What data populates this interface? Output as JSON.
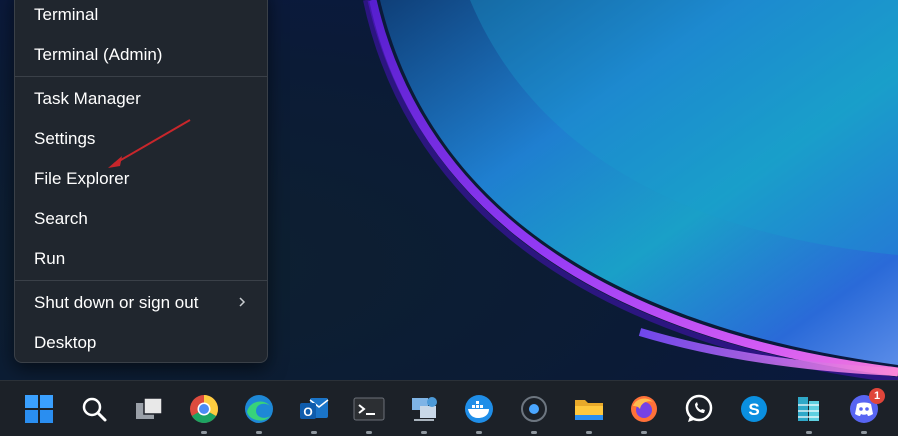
{
  "context_menu": {
    "items": [
      {
        "label": "Terminal"
      },
      {
        "label": "Terminal (Admin)"
      },
      {
        "label": "Task Manager"
      },
      {
        "label": "Settings"
      },
      {
        "label": "File Explorer"
      },
      {
        "label": "Search"
      },
      {
        "label": "Run"
      },
      {
        "label": "Shut down or sign out",
        "has_submenu": true
      },
      {
        "label": "Desktop"
      }
    ]
  },
  "taskbar": {
    "apps": [
      {
        "name": "start",
        "icon": "windows-logo-icon",
        "running": false
      },
      {
        "name": "search",
        "icon": "search-icon",
        "running": false
      },
      {
        "name": "task-view",
        "icon": "task-view-icon",
        "running": false
      },
      {
        "name": "chrome",
        "icon": "chrome-icon",
        "running": true
      },
      {
        "name": "edge",
        "icon": "edge-icon",
        "running": true
      },
      {
        "name": "outlook",
        "icon": "outlook-icon",
        "running": true
      },
      {
        "name": "terminal",
        "icon": "terminal-icon",
        "running": true
      },
      {
        "name": "network-tool",
        "icon": "network-tool-icon",
        "running": true
      },
      {
        "name": "docker",
        "icon": "docker-icon",
        "running": true
      },
      {
        "name": "cortana",
        "icon": "cortana-icon",
        "running": true
      },
      {
        "name": "file-explorer",
        "icon": "file-explorer-icon",
        "running": true
      },
      {
        "name": "firefox",
        "icon": "firefox-icon",
        "running": true
      },
      {
        "name": "whatsapp",
        "icon": "whatsapp-icon",
        "running": false
      },
      {
        "name": "skype",
        "icon": "skype-icon",
        "running": false
      },
      {
        "name": "database-tool",
        "icon": "database-icon",
        "running": true
      },
      {
        "name": "discord",
        "icon": "discord-icon",
        "running": true,
        "badge": "1"
      }
    ]
  },
  "colors": {
    "menu_bg": "#20262e",
    "taskbar_bg": "#1c2128",
    "annotation": "#c8262b",
    "wallpaper_glow": "#8a3cff"
  }
}
